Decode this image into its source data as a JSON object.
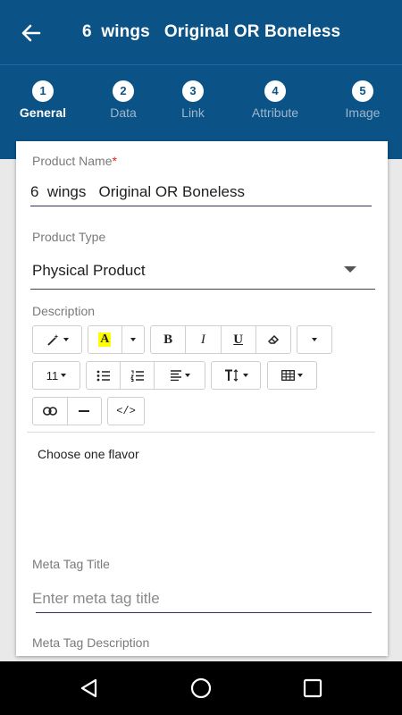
{
  "header": {
    "title": "6  wings   Original OR Boneless",
    "back_icon": "back-arrow-icon"
  },
  "colors": {
    "primary": "#0b5386",
    "inactive_step_text": "#9db7cd",
    "required": "#e02020"
  },
  "steps": [
    {
      "num": "1",
      "label": "General",
      "active": true
    },
    {
      "num": "2",
      "label": "Data",
      "active": false
    },
    {
      "num": "3",
      "label": "Link",
      "active": false
    },
    {
      "num": "4",
      "label": "Attribute",
      "active": false
    },
    {
      "num": "5",
      "label": "Image",
      "active": false
    }
  ],
  "form": {
    "product_name_label": "Product Name",
    "required_mark": "*",
    "product_name_value": "6  wings   Original OR Boneless",
    "product_type_label": "Product Type",
    "product_type_value": "Physical Product",
    "description_label": "Description",
    "description_text": "Choose one flavor",
    "meta_title_label": "Meta Tag Title",
    "meta_title_placeholder": "Enter meta tag title",
    "meta_desc_label": "Meta Tag Description"
  },
  "toolbar": {
    "font_size": "11",
    "bold": "B",
    "italic": "I",
    "underline": "U",
    "color": "A",
    "code": "</>"
  },
  "nav": {
    "back": "nav-back-icon",
    "home": "nav-home-icon",
    "recents": "nav-recents-icon"
  }
}
